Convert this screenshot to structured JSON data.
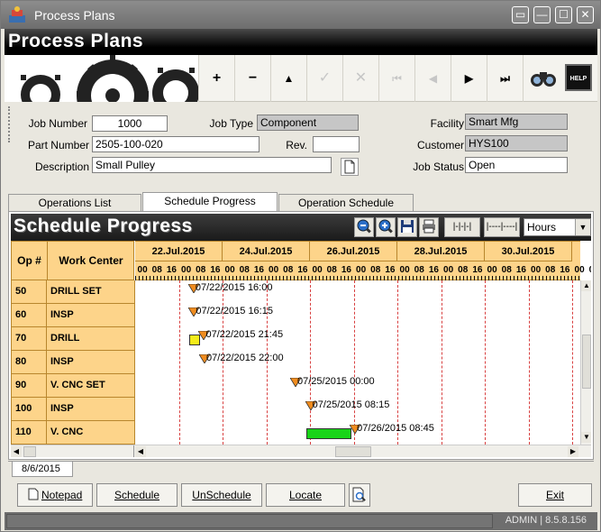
{
  "window": {
    "title": "Process Plans",
    "controls": [
      "▭",
      "—",
      "☐",
      "✕"
    ]
  },
  "banner_title": "Process Plans",
  "toolbar": {
    "add": "+",
    "remove": "−",
    "up": "▲",
    "save": "✓",
    "cancel": "✕",
    "first": "⏮",
    "prev": "◀",
    "next": "▶",
    "last": "⏭",
    "help": "HELP"
  },
  "form": {
    "job_number_label": "Job Number",
    "job_number": "1000",
    "job_type_label": "Job Type",
    "job_type": "Component",
    "facility_label": "Facility",
    "facility": "Smart Mfg",
    "part_number_label": "Part Number",
    "part_number": "2505-100-020",
    "rev_label": "Rev.",
    "rev": "",
    "customer_label": "Customer",
    "customer": "HYS100",
    "description_label": "Description",
    "description": "Small Pulley",
    "job_status_label": "Job Status",
    "job_status": "Open"
  },
  "tabs": [
    "Operations List",
    "Schedule Progress",
    "Operation Schedule"
  ],
  "schedule": {
    "title": "Schedule Progress",
    "zoom_out": "−",
    "zoom_in": "+",
    "btn_a": "|-|-|-|",
    "btn_b": "|----|----|",
    "unit": "Hours",
    "col_op": "Op #",
    "col_wc": "Work Center",
    "dates": [
      "22.Jul.2015",
      "24.Jul.2015",
      "26.Jul.2015",
      "28.Jul.2015",
      "30.Jul.2015"
    ],
    "hours": [
      "00",
      "08",
      "16"
    ],
    "rows": [
      {
        "op": "50",
        "wc": "DRILL SET",
        "label": "07/22/2015 16:00"
      },
      {
        "op": "60",
        "wc": "INSP",
        "label": "07/22/2015 16:15"
      },
      {
        "op": "70",
        "wc": "DRILL",
        "label": "07/22/2015 21:45"
      },
      {
        "op": "80",
        "wc": "INSP",
        "label": "07/22/2015 22:00"
      },
      {
        "op": "90",
        "wc": "V. CNC SET",
        "label": "07/25/2015 00:00"
      },
      {
        "op": "100",
        "wc": "INSP",
        "label": "07/25/2015 08:15"
      },
      {
        "op": "110",
        "wc": "V. CNC",
        "label": "07/26/2015 08:45"
      }
    ]
  },
  "date_tab": "8/6/2015",
  "buttons": {
    "notepad": "Notepad",
    "schedule": "Schedule",
    "unschedule": "UnSchedule",
    "locate": "Locate",
    "exit": "Exit"
  },
  "status": "ADMIN | 8.5.8.156",
  "colors": {
    "header_orange": "#fdd48a",
    "milestone": "#f08c1e",
    "bar_green": "#18d418",
    "bar_yellow": "#f4ec1a",
    "grid_red": "#d84040"
  }
}
